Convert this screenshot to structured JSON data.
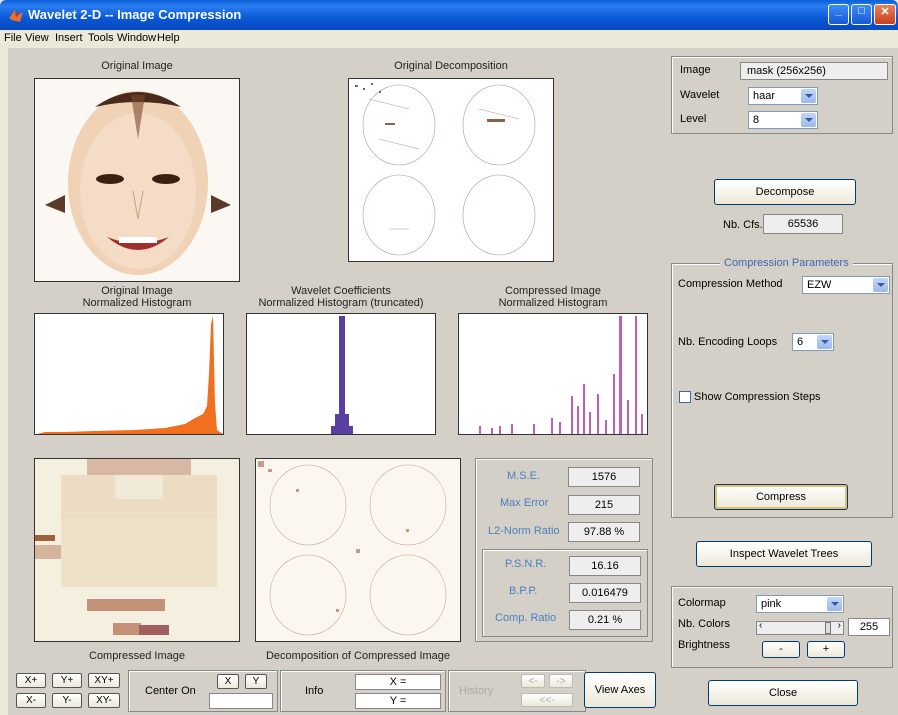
{
  "window": {
    "title": "Wavelet 2-D -- Image Compression"
  },
  "menu": [
    "File",
    "View",
    "Insert",
    "Tools",
    "Window",
    "Help"
  ],
  "plots": {
    "original_image": "Original Image",
    "original_decomposition": "Original Decomposition",
    "hist_original": [
      "Original Image",
      "Normalized Histogram"
    ],
    "hist_coeffs": [
      "Wavelet Coefficients",
      "Normalized Histogram (truncated)"
    ],
    "hist_compressed": [
      "Compressed Image",
      "Normalized Histogram"
    ],
    "compressed_image": "Compressed Image",
    "decomp_compressed": "Decomposition of Compressed Image"
  },
  "stats": {
    "mse_label": "M.S.E.",
    "mse": "1576",
    "maxerr_label": "Max Error",
    "maxerr": "215",
    "l2_label": "L2-Norm Ratio",
    "l2": "97.88 %",
    "psnr_label": "P.S.N.R.",
    "psnr": "16.16",
    "bpp_label": "B.P.P.",
    "bpp": "0.016479",
    "ratio_label": "Comp. Ratio",
    "ratio": "0.21 %"
  },
  "right": {
    "image_label": "Image",
    "image_value": "mask  (256x256)",
    "wavelet_label": "Wavelet",
    "wavelet_value": "haar",
    "level_label": "Level",
    "level_value": "8",
    "decompose": "Decompose",
    "nbcfs_label": "Nb. Cfs.",
    "nbcfs_value": "65536",
    "comp_params": "Compression Parameters",
    "method_label": "Compression Method",
    "method_value": "EZW",
    "loops_label": "Nb. Encoding Loops",
    "loops_value": "6",
    "show_steps": "Show Compression Steps",
    "compress": "Compress",
    "inspect": "Inspect Wavelet Trees",
    "colormap_label": "Colormap",
    "colormap_value": "pink",
    "nbcolors_label": "Nb. Colors",
    "nbcolors_value": "255",
    "brightness_label": "Brightness",
    "minus": "-",
    "plus": "+",
    "close": "Close"
  },
  "bottom": {
    "xplus": "X+",
    "yplus": "Y+",
    "xyplus": "XY+",
    "xminus": "X-",
    "yminus": "Y-",
    "xyminus": "XY-",
    "center_on": "Center On",
    "cx": "X",
    "cy": "Y",
    "info": "Info",
    "xeq": "X =",
    "yeq": "Y =",
    "history": "History",
    "hback": "<-",
    "hfwd": "->",
    "hstart": "<<-",
    "view_axes": "View Axes"
  },
  "colors": {
    "orange": "#f07020",
    "purple": "#5a3fa0",
    "pink": "#c060b0",
    "titlebar": "#0a58d6"
  }
}
